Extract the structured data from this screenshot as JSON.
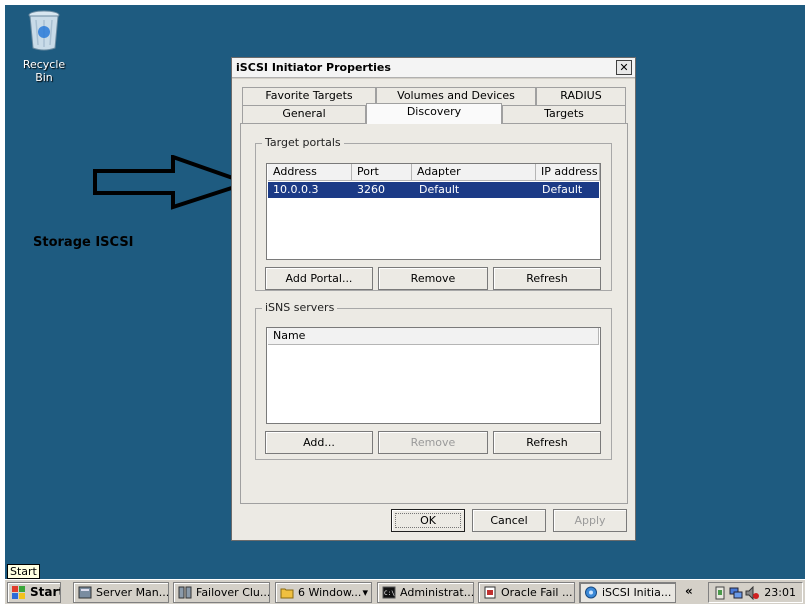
{
  "desktop": {
    "recycle_bin_label": "Recycle Bin",
    "annotation_text": "Storage ISCSI",
    "background_color": "#1e5b80"
  },
  "window": {
    "title": "iSCSI Initiator Properties",
    "close_glyph": "✕",
    "tabs_row1": [
      "Favorite Targets",
      "Volumes and Devices",
      "RADIUS"
    ],
    "tabs_row2": [
      "General",
      "Discovery",
      "Targets"
    ],
    "active_tab": "Discovery",
    "target_portals": {
      "legend": "Target portals",
      "columns": [
        "Address",
        "Port",
        "Adapter",
        "IP address"
      ],
      "rows": [
        {
          "address": "10.0.0.3",
          "port": "3260",
          "adapter": "Default",
          "ip": "Default"
        }
      ],
      "buttons": {
        "add": "Add Portal...",
        "remove": "Remove",
        "refresh": "Refresh"
      }
    },
    "isns_servers": {
      "legend": "iSNS servers",
      "columns": [
        "Name"
      ],
      "buttons": {
        "add": "Add...",
        "remove": "Remove",
        "refresh": "Refresh"
      }
    },
    "footer": {
      "ok": "OK",
      "cancel": "Cancel",
      "apply": "Apply"
    }
  },
  "taskbar": {
    "start_label": "Start",
    "start_tooltip": "Start",
    "items": [
      {
        "label": "Server Man...",
        "icon": "server-manager-icon"
      },
      {
        "label": "Failover Clu...",
        "icon": "failover-cluster-icon"
      },
      {
        "label": "6 Window...",
        "icon": "folder-icon"
      },
      {
        "label": "Administrat...",
        "icon": "command-prompt-icon"
      },
      {
        "label": "Oracle Fail ...",
        "icon": "oracle-icon"
      },
      {
        "label": "iSCSI Initia...",
        "icon": "iscsi-icon"
      }
    ],
    "chevron": "«",
    "clock": "23:01"
  }
}
